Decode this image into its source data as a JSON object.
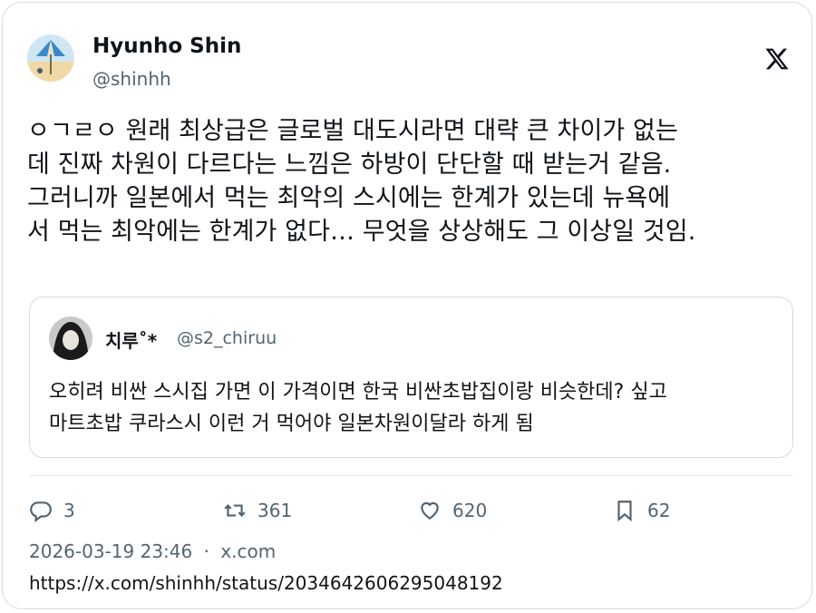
{
  "author": {
    "name": "Hyunho Shin",
    "handle": "@shinhh"
  },
  "tweet": {
    "lines": [
      "ㅇㄱㄹㅇ 원래 최상급은 글로벌 대도시라면 대략 큰 차이가 없는",
      "데 진짜 차원이 다르다는 느낌은 하방이 단단할 때 받는거 같음.",
      "그러니까 일본에서 먹는 최악의 스시에는 한계가 있는데 뉴욕에",
      "서 먹는 최악에는 한계가 없다… 무엇을 상상해도 그 이상일 것임."
    ]
  },
  "quote": {
    "name": "치루˚*",
    "handle": "@s2_chiruu",
    "lines": [
      "오히려 비싼 스시집 가면 이 가격이면 한국 비싼초밥집이랑 비슷한데? 싶고",
      "마트초밥 쿠라스시 이런 거 먹어야 일본차원이달라 하게 됨"
    ]
  },
  "actions": {
    "replies": "3",
    "retweets": "361",
    "likes": "620",
    "bookmarks": "62"
  },
  "meta": {
    "timestamp": "2026-03-19 23:46",
    "separator": "·",
    "source": "x.com",
    "url": "https://x.com/shinhh/status/2034642606295048192"
  },
  "icons": {
    "platform": "x-logo-icon",
    "reply": "reply-icon",
    "retweet": "retweet-icon",
    "like": "heart-icon",
    "bookmark": "bookmark-icon"
  },
  "colors": {
    "text": "#0f1419",
    "secondary": "#536471",
    "border": "#d5dbe0"
  }
}
